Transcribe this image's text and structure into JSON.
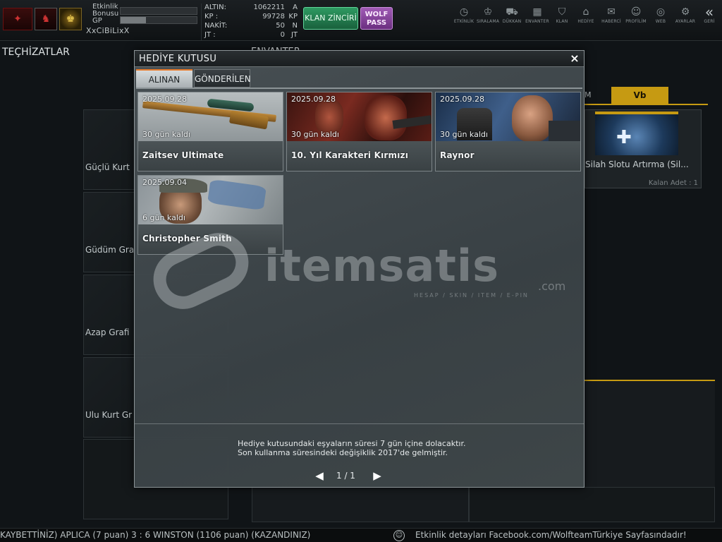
{
  "player": {
    "event_bonus_label": "Etkinlik Bonusu",
    "event_bonus_progress": 0,
    "gp_label": "GP",
    "gp_progress": 0.33,
    "username": "XxCiBiLixX"
  },
  "currency": [
    {
      "key": "ALTIN:",
      "value": "1062211",
      "unit": "A"
    },
    {
      "key": "KP :",
      "value": "99728",
      "unit": "KP"
    },
    {
      "key": "NAKİT:",
      "value": "50",
      "unit": "N"
    },
    {
      "key": "JT :",
      "value": "0",
      "unit": "JT"
    }
  ],
  "promo": {
    "klan_label": "KLAN ZİNCİRİ",
    "wolf_label_1": "WOLF",
    "wolf_label_2": "PASS"
  },
  "nav": [
    {
      "label": "ETKİNLİK",
      "icon": "clock-icon",
      "glyph": "◷"
    },
    {
      "label": "SIRALAMA",
      "icon": "medal-icon",
      "glyph": "♔"
    },
    {
      "label": "DÜKKAN",
      "icon": "cart-icon",
      "glyph": "⛟"
    },
    {
      "label": "ENVANTER",
      "icon": "inventory-icon",
      "glyph": "▦"
    },
    {
      "label": "KLAN",
      "icon": "shield-icon",
      "glyph": "⛉"
    },
    {
      "label": "HEDİYE",
      "icon": "gift-icon",
      "glyph": "⌂"
    },
    {
      "label": "HABERCİ",
      "icon": "megaphone-icon",
      "glyph": "✉"
    },
    {
      "label": "PROFİLİM",
      "icon": "profile-icon",
      "glyph": "☺"
    },
    {
      "label": "WEB",
      "icon": "globe-icon",
      "glyph": "◎"
    },
    {
      "label": "AYARLAR",
      "icon": "gear-icon",
      "glyph": "⚙"
    },
    {
      "label": "GERİ",
      "icon": "back-icon",
      "glyph": "«"
    }
  ],
  "background": {
    "equipment_title": "TEÇHİZATLAR",
    "inventory_title": "ENVANTER",
    "left_items": [
      "Güçlü Kurt",
      "Güdüm Gra",
      "Azap Grafi",
      "Ulu Kurt Gr"
    ],
    "tab_m": "M",
    "tab_vb": "Vb",
    "right_item_name": "Silah Slotu Artırma (Sil...",
    "right_item_count": "Kalan Adet : 1"
  },
  "modal": {
    "title": "HEDİYE KUTUSU",
    "close_glyph": "×",
    "tab_received": "ALINAN",
    "tab_sent": "GÖNDERİLEN",
    "gifts": [
      {
        "date": "2025.09.28",
        "remaining": "30 gün kaldı",
        "name": "Zaitsev Ultimate"
      },
      {
        "date": "2025.09.28",
        "remaining": "30 gün kaldı",
        "name": "10. Yıl Karakteri Kırmızı"
      },
      {
        "date": "2025.09.28",
        "remaining": "30 gün kaldı",
        "name": "Raynor"
      },
      {
        "date": "2025.09.04",
        "remaining": "6 gün kaldı",
        "name": "Christopher Smith"
      }
    ],
    "note_line1": "Hediye kutusundaki eşyaların süresi 7 gün içine dolacaktır.",
    "note_line2": "Son kullanma süresindeki değişiklik 2017'de gelmiştir.",
    "page_indicator": "1 / 1"
  },
  "watermark": {
    "word": "itemsatis",
    "domain": ".com",
    "tagline": "HESAP / SKIN / ITEM / E-PIN"
  },
  "ticker": {
    "left_text": "KAYBETTİNİZ) APLICA (7 puan) 3 : 6 WINSTON (1106 puan) (KAZANDINIZ)",
    "right_text": "Etkinlik detayları Facebook.com/WolfteamTürkiye Sayfasındadır!"
  }
}
